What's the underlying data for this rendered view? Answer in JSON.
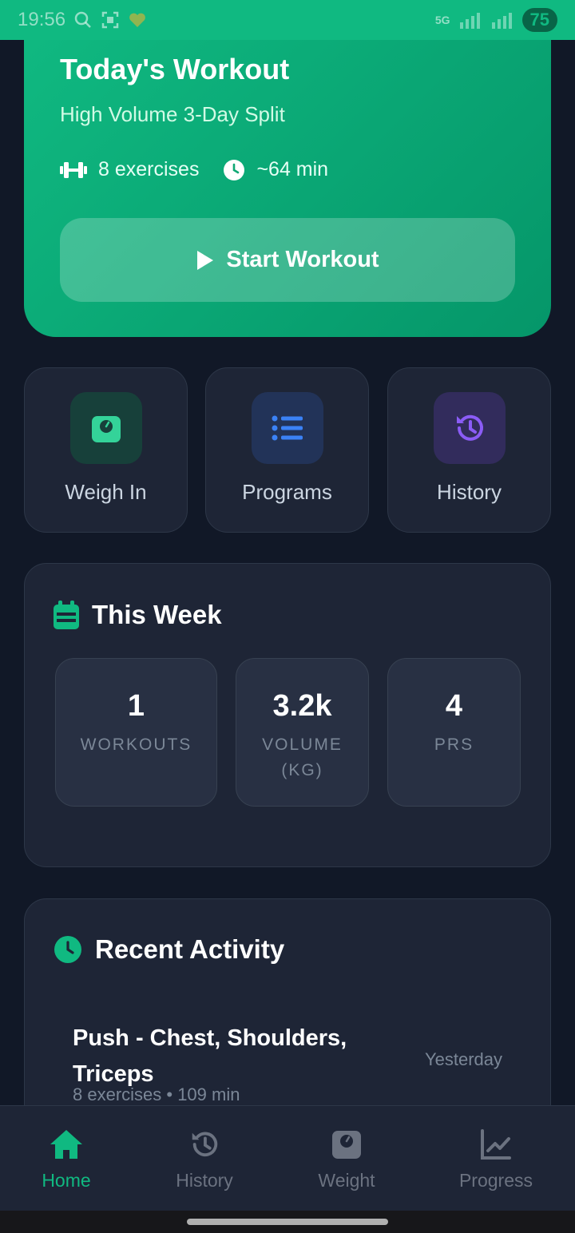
{
  "status_bar": {
    "time": "19:56",
    "battery": "75",
    "network": "5G"
  },
  "hero": {
    "title": "Today's Workout",
    "subtitle": "High Volume 3-Day Split",
    "exercises": "8 exercises",
    "duration": "~64 min",
    "start_label": "Start Workout"
  },
  "quick_actions": [
    {
      "label": "Weigh In",
      "icon": "scale-icon",
      "color": "#34d399"
    },
    {
      "label": "Programs",
      "icon": "list-icon",
      "color": "#3b82f6"
    },
    {
      "label": "History",
      "icon": "history-icon",
      "color": "#8b5cf6"
    }
  ],
  "this_week": {
    "title": "This Week",
    "stats": [
      {
        "value": "1",
        "label": "WORKOUTS"
      },
      {
        "value": "3.2k",
        "label": "VOLUME",
        "label2": "(KG)"
      },
      {
        "value": "4",
        "label": "PRS"
      }
    ]
  },
  "recent_activity": {
    "title": "Recent Activity",
    "items": [
      {
        "title": "Push - Chest, Shoulders, Triceps",
        "meta": "8 exercises • 109 min",
        "date": "Yesterday"
      }
    ]
  },
  "bottom_nav": [
    {
      "label": "Home",
      "icon": "home-icon",
      "active": true
    },
    {
      "label": "History",
      "icon": "history-icon",
      "active": false
    },
    {
      "label": "Weight",
      "icon": "scale-icon",
      "active": false
    },
    {
      "label": "Progress",
      "icon": "chart-line-icon",
      "active": false
    }
  ],
  "colors": {
    "accent": "#10b981",
    "background": "#111827",
    "card": "#1e2536"
  }
}
